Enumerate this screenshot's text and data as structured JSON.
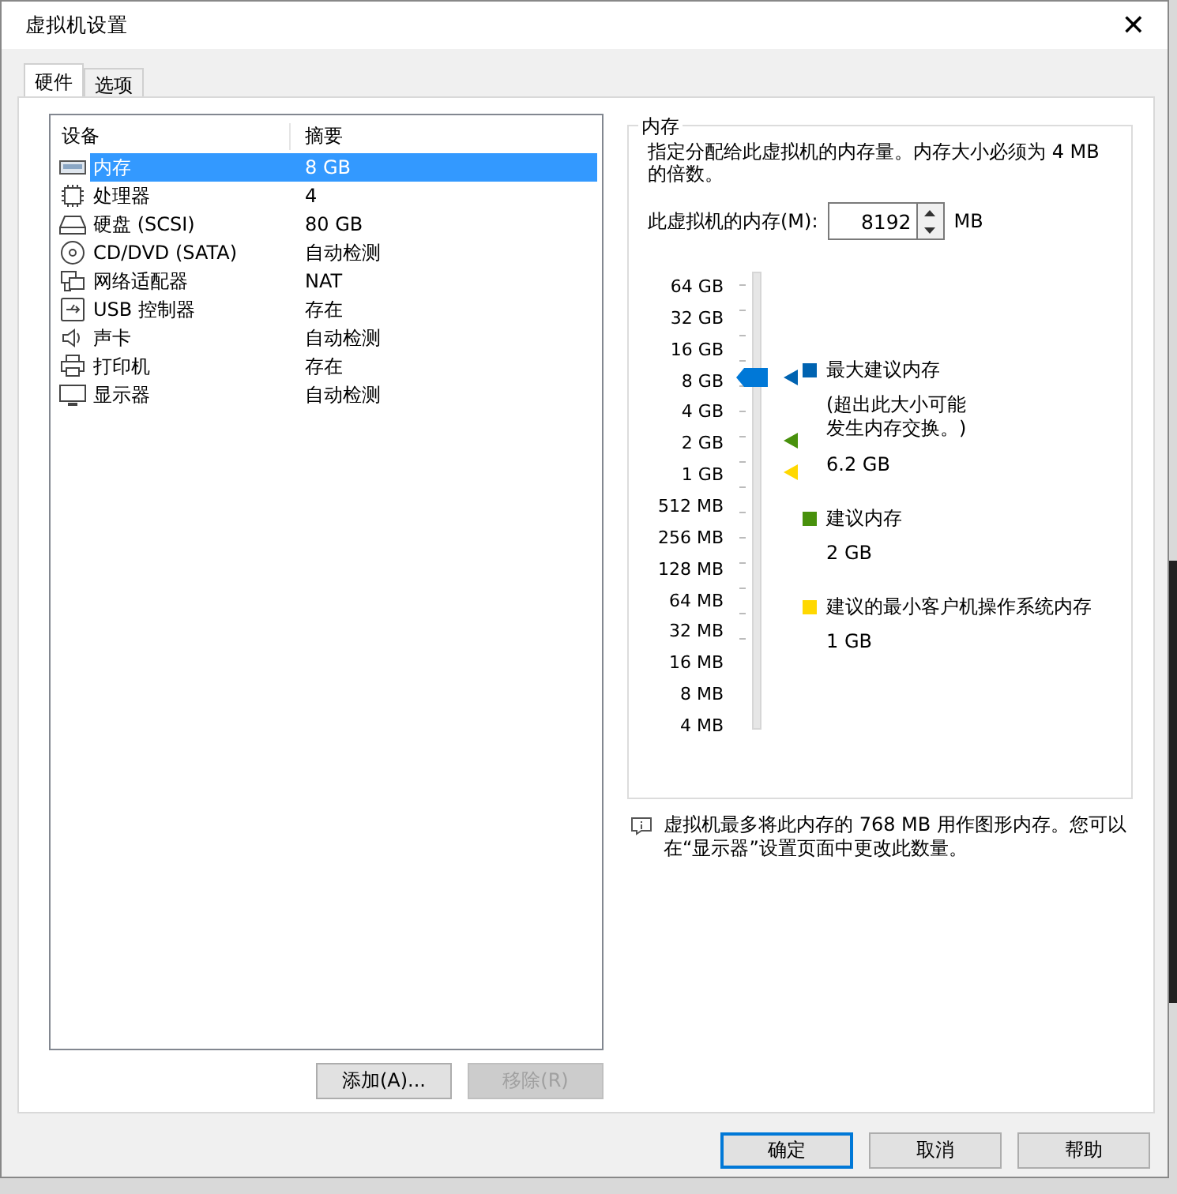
{
  "window": {
    "title": "虚拟机设置",
    "close": "✕"
  },
  "tabs": [
    {
      "label": "硬件",
      "selected": true
    },
    {
      "label": "选项",
      "selected": false
    }
  ],
  "devices": {
    "columns": [
      "设备",
      "摘要"
    ],
    "rows": [
      {
        "kind": "memory",
        "device": "内存",
        "summary": "8 GB",
        "selected": true
      },
      {
        "kind": "cpu",
        "device": "处理器",
        "summary": "4",
        "selected": false
      },
      {
        "kind": "disk",
        "device": "硬盘 (SCSI)",
        "summary": "80 GB",
        "selected": false
      },
      {
        "kind": "cd",
        "device": "CD/DVD (SATA)",
        "summary": "自动检测",
        "selected": false
      },
      {
        "kind": "network",
        "device": "网络适配器",
        "summary": "NAT",
        "selected": false
      },
      {
        "kind": "usb",
        "device": "USB 控制器",
        "summary": "存在",
        "selected": false
      },
      {
        "kind": "sound",
        "device": "声卡",
        "summary": "自动检测",
        "selected": false
      },
      {
        "kind": "printer",
        "device": "打印机",
        "summary": "存在",
        "selected": false
      },
      {
        "kind": "display",
        "device": "显示器",
        "summary": "自动检测",
        "selected": false
      }
    ]
  },
  "device_buttons": [
    {
      "label": "添加(A)...",
      "disabled": false
    },
    {
      "label": "移除(R)",
      "disabled": true
    }
  ],
  "memory": {
    "title": "内存",
    "description": "指定分配给此虚拟机的内存量。内存大小必须为 4 MB 的倍数。",
    "field_label": "此虚拟机的内存(M):",
    "value": "8192",
    "unit": "MB",
    "scale": [
      "64 GB",
      "32 GB",
      "16 GB",
      "8 GB",
      "4 GB",
      "2 GB",
      "1 GB",
      "512 MB",
      "256 MB",
      "128 MB",
      "64 MB",
      "32 MB",
      "16 MB",
      "8 MB",
      "4 MB"
    ],
    "level": 0.786,
    "markers": [
      {
        "color": "#0063b1",
        "level": 0.786
      },
      {
        "color": "#48910c",
        "level": 0.643
      },
      {
        "color": "#ffd800",
        "level": 0.571
      }
    ],
    "legend": [
      {
        "title": "最大建议内存",
        "note": "(超出此大小可能发生内存交换。)",
        "value": "6.2 GB",
        "color": "#0063b1"
      },
      {
        "title": "建议内存",
        "value": "2 GB",
        "color": "#48910c"
      },
      {
        "title": "建议的最小客户机操作系统内存",
        "value": "1 GB",
        "color": "#ffd800"
      }
    ]
  },
  "info": "虚拟机最多将此内存的 768 MB 用作图形内存。您可以在“显示器”设置页面中更改此数量。",
  "dialog_buttons": [
    {
      "label": "确定",
      "default": true
    },
    {
      "label": "取消",
      "default": false
    },
    {
      "label": "帮助",
      "default": false
    }
  ]
}
